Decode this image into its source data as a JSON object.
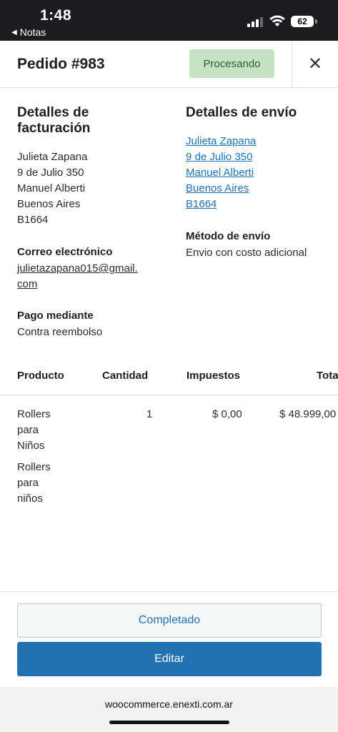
{
  "status_bar": {
    "time": "1:48",
    "back_app": "Notas",
    "battery": "62"
  },
  "header": {
    "title": "Pedido #983",
    "status": "Procesando",
    "close_glyph": "✕"
  },
  "billing": {
    "title_line1": "Detalles de",
    "title_line2": "facturación",
    "address": [
      "Julieta Zapana",
      "9 de Julio 350",
      "Manuel Alberti",
      "Buenos Aires",
      "B1664"
    ],
    "email_label": "Correo electrónico",
    "email_line1": "julietazapana015@gmail.",
    "email_line2": "com",
    "payment_label": "Pago mediante",
    "payment_value": "Contra reembolso"
  },
  "shipping": {
    "title": "Detalles de envío",
    "address": [
      "Julieta Zapana",
      "9 de Julio 350",
      "Manuel Alberti",
      "Buenos Aires",
      "B1664"
    ],
    "method_label": "Método de envío",
    "method_value": "Envio con costo adicional"
  },
  "table": {
    "headers": [
      "Producto",
      "Cantidad",
      "Impuestos",
      "Total"
    ],
    "rows": [
      {
        "product_lines": [
          "Rollers",
          "para",
          "Niños"
        ],
        "variation_lines": [
          "Rollers",
          "para",
          "niños"
        ],
        "quantity": "1",
        "tax": "$ 0,00",
        "total": "$ 48.999,00"
      }
    ]
  },
  "actions": {
    "complete_label": "Completado",
    "edit_label": "Editar"
  },
  "browser": {
    "url": "woocommerce.enexti.com.ar"
  },
  "colors": {
    "accent": "#2271b1",
    "status_bg": "#c6e1c6",
    "status_text": "#2c5e2e"
  }
}
